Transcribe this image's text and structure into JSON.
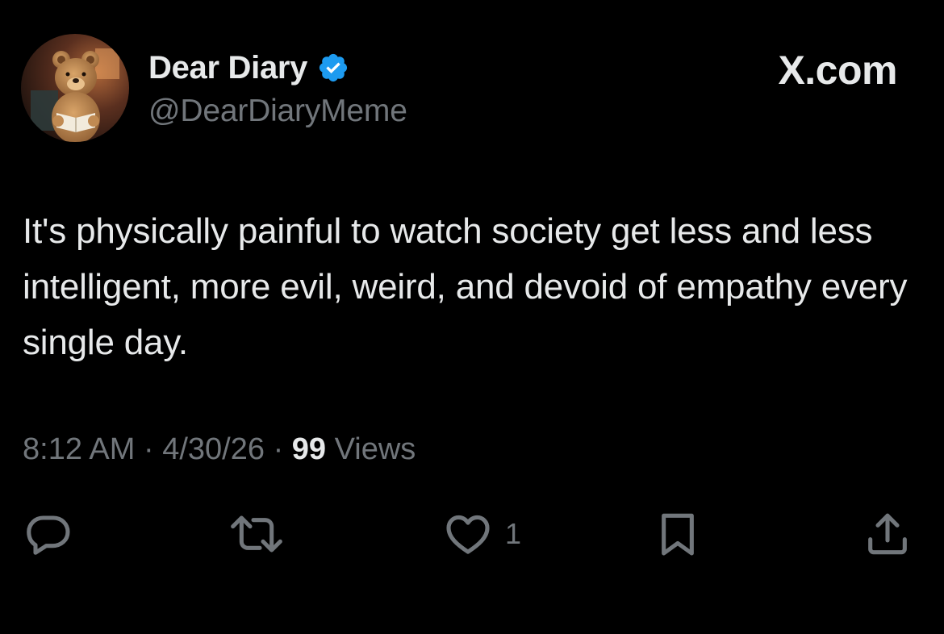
{
  "tweet": {
    "author": {
      "display_name": "Dear Diary",
      "handle": "@DearDiaryMeme",
      "verified": true,
      "avatar_icon": "teddy-bear-reading-avatar"
    },
    "site_logo": "X.com",
    "text": "It's physically painful to watch society get less and less intelligent, more evil, weird, and devoid of empathy every single day.",
    "meta": {
      "time": "8:12 AM",
      "separator": "·",
      "date": "4/30/26",
      "views_count": "99",
      "views_label": "Views"
    },
    "actions": {
      "reply_icon": "reply-icon",
      "retweet_icon": "retweet-icon",
      "like_icon": "heart-icon",
      "like_count": "1",
      "bookmark_icon": "bookmark-icon",
      "share_icon": "share-icon"
    }
  },
  "colors": {
    "background": "#000000",
    "primary_text": "#e7e9ea",
    "secondary_text": "#71767b",
    "verified_blue": "#1d9bf0"
  }
}
